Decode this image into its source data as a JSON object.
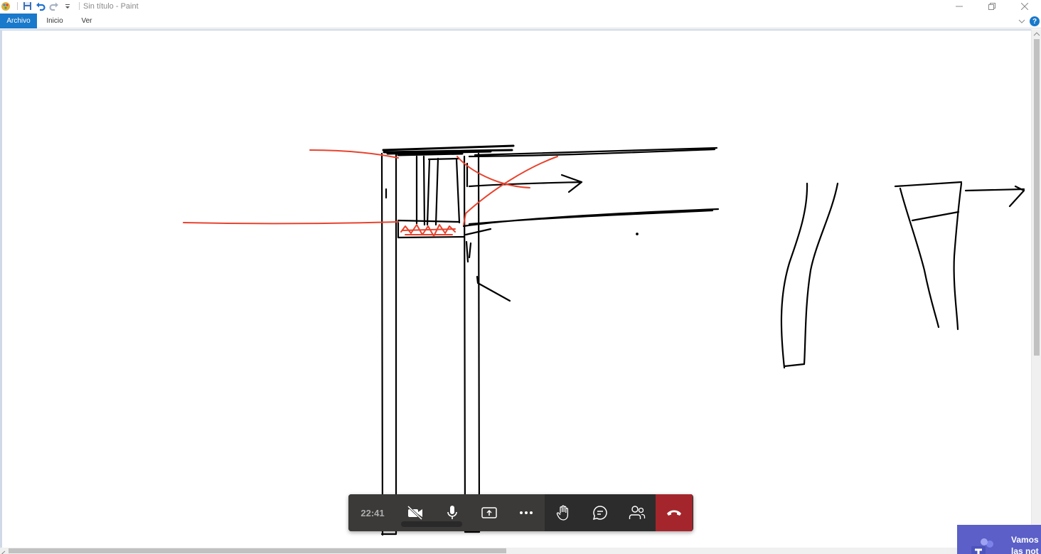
{
  "window": {
    "title": "Sin título - Paint"
  },
  "ribbon": {
    "tabs": [
      {
        "label": "Archivo",
        "active": true
      },
      {
        "label": "Inicio",
        "active": false
      },
      {
        "label": "Ver",
        "active": false
      }
    ],
    "help_label": "?"
  },
  "callbar": {
    "timer": "22:41",
    "buttons": [
      "camera-off",
      "microphone",
      "share-screen",
      "more-options",
      "raise-hand",
      "chat",
      "participants",
      "hang-up"
    ]
  },
  "toast": {
    "line1": "Vamos",
    "line2": "las not"
  },
  "colors": {
    "accent": "#1979ca",
    "hangup": "#a4262c",
    "teams": "#5b5fc7",
    "stroke_red": "#e8432e",
    "stroke_black": "#000000"
  }
}
